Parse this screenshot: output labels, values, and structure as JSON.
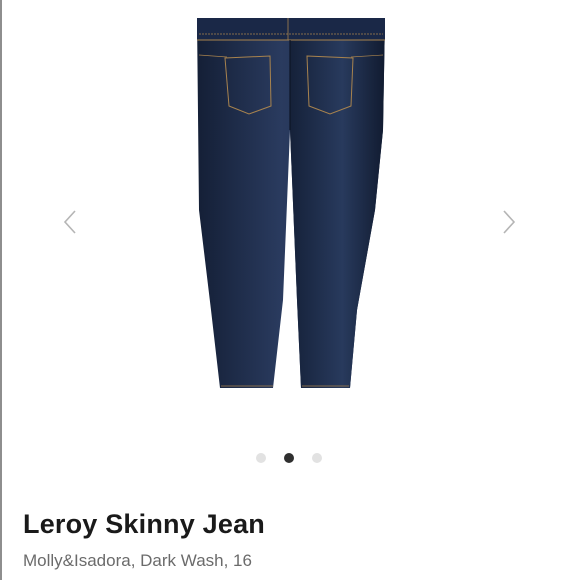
{
  "product": {
    "title": "Leroy Skinny Jean",
    "subtitle": "Molly&Isadora, Dark Wash, 16"
  },
  "carousel": {
    "slide_count": 3,
    "active_index": 1,
    "image_subject": "dark wash skinny jeans, back view",
    "prev_icon": "chevron-left-icon",
    "next_icon": "chevron-right-icon"
  },
  "colors": {
    "denim": "#1c2a45",
    "stitch": "#a8834e",
    "dot_active": "#2f2f2f",
    "dot_inactive": "#e2e2e2",
    "title_text": "#1a1a1a",
    "subtitle_text": "#6b6b6b"
  }
}
